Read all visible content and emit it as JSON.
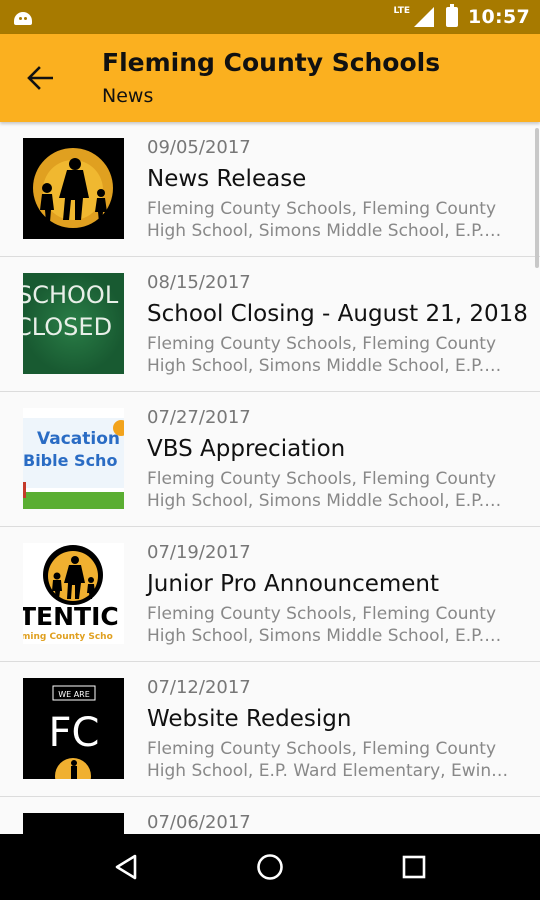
{
  "status_bar": {
    "network_label": "LTE",
    "time": "10:57",
    "icons": [
      "android-icon",
      "signal-icon",
      "battery-icon"
    ]
  },
  "app_bar": {
    "title": "Fleming County Schools",
    "subtitle": "News",
    "back_icon": "arrow-back-icon",
    "color": "#fbb01f"
  },
  "news": [
    {
      "date": "09/05/2017",
      "title": "News Release",
      "description": "Fleming County Schools, Fleming County High School, Simons Middle School, E.P. Ward Elementary",
      "thumbnail": "silhouette-family-logo"
    },
    {
      "date": "08/15/2017",
      "title": "School Closing - August 21, 2018",
      "description": "Fleming County Schools, Fleming County High School, Simons Middle School, E.P. Ward Elementary",
      "thumbnail": "chalkboard-school-closed",
      "thumb_text": [
        "SCHOOL",
        "CLOSED"
      ]
    },
    {
      "date": "07/27/2017",
      "title": "VBS Appreciation",
      "description": "Fleming County Schools, Fleming County High School, Simons Middle School, E.P. Ward Elementary",
      "thumbnail": "vacation-bible-school",
      "thumb_text": [
        "Vacation",
        "Bible Scho"
      ]
    },
    {
      "date": "07/19/2017",
      "title": "Junior Pro Announcement",
      "description": "Fleming County Schools, Fleming County High School, Simons Middle School, E.P. Ward Elementary",
      "thumbnail": "attention-logo",
      "thumb_text": [
        "TENTIC",
        "ming County Scho"
      ]
    },
    {
      "date": "07/12/2017",
      "title": "Website Redesign",
      "description": "Fleming County Schools, Fleming County High School, E.P. Ward Elementary, Ewing Elementary",
      "thumbnail": "we-are-fc",
      "thumb_text": [
        "WE ARE",
        "FC"
      ]
    },
    {
      "date": "07/06/2017",
      "title": "",
      "description": "",
      "thumbnail": "dark"
    }
  ],
  "nav_bar": {
    "icons": [
      "back-triangle-icon",
      "home-circle-icon",
      "recents-square-icon"
    ]
  }
}
